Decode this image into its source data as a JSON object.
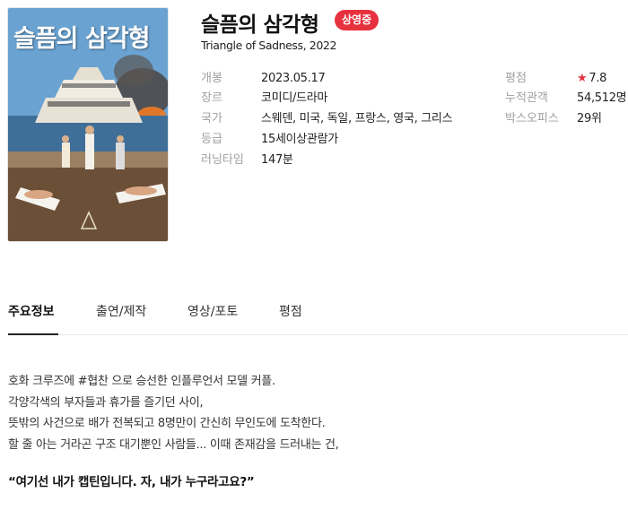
{
  "poster": {
    "title_text": "슬픔의 삼각형"
  },
  "header": {
    "title": "슬픔의 삼각형",
    "status_badge": "상영중",
    "original_title": "Triangle of Sadness, 2022"
  },
  "info_left": [
    {
      "label": "개봉",
      "value": "2023.05.17"
    },
    {
      "label": "장르",
      "value": "코미디/드라마"
    },
    {
      "label": "국가",
      "value": "스웨덴, 미국, 독일, 프랑스, 영국, 그리스"
    },
    {
      "label": "등급",
      "value": "15세이상관람가"
    },
    {
      "label": "러닝타임",
      "value": "147분"
    }
  ],
  "info_right": [
    {
      "label": "평점",
      "value": "7.8",
      "icon": "star-icon"
    },
    {
      "label": "누적관객",
      "value": "54,512명"
    },
    {
      "label": "박스오피스",
      "value": "29위"
    }
  ],
  "tabs": [
    {
      "label": "주요정보",
      "active": true
    },
    {
      "label": "출연/제작",
      "active": false
    },
    {
      "label": "영상/포토",
      "active": false
    },
    {
      "label": "평점",
      "active": false
    }
  ],
  "synopsis": {
    "lines": [
      "호화 크루즈에 #협찬 으로 승선한 인플루언서 모델 커플.",
      "각양각색의 부자들과 휴가를 즐기던 사이,",
      "뜻밖의 사건으로 배가 전복되고 8명만이 간신히 무인도에 도착한다.",
      "할 줄 아는 거라곤 구조 대기뿐인 사람들... 이때 존재감을 드러내는 건,"
    ],
    "tagline": "“여기선 내가 캡틴입니다. 자, 내가 누구라고요?”"
  },
  "colors": {
    "accent": "#e8313e",
    "label_gray": "#a0a0a0"
  }
}
